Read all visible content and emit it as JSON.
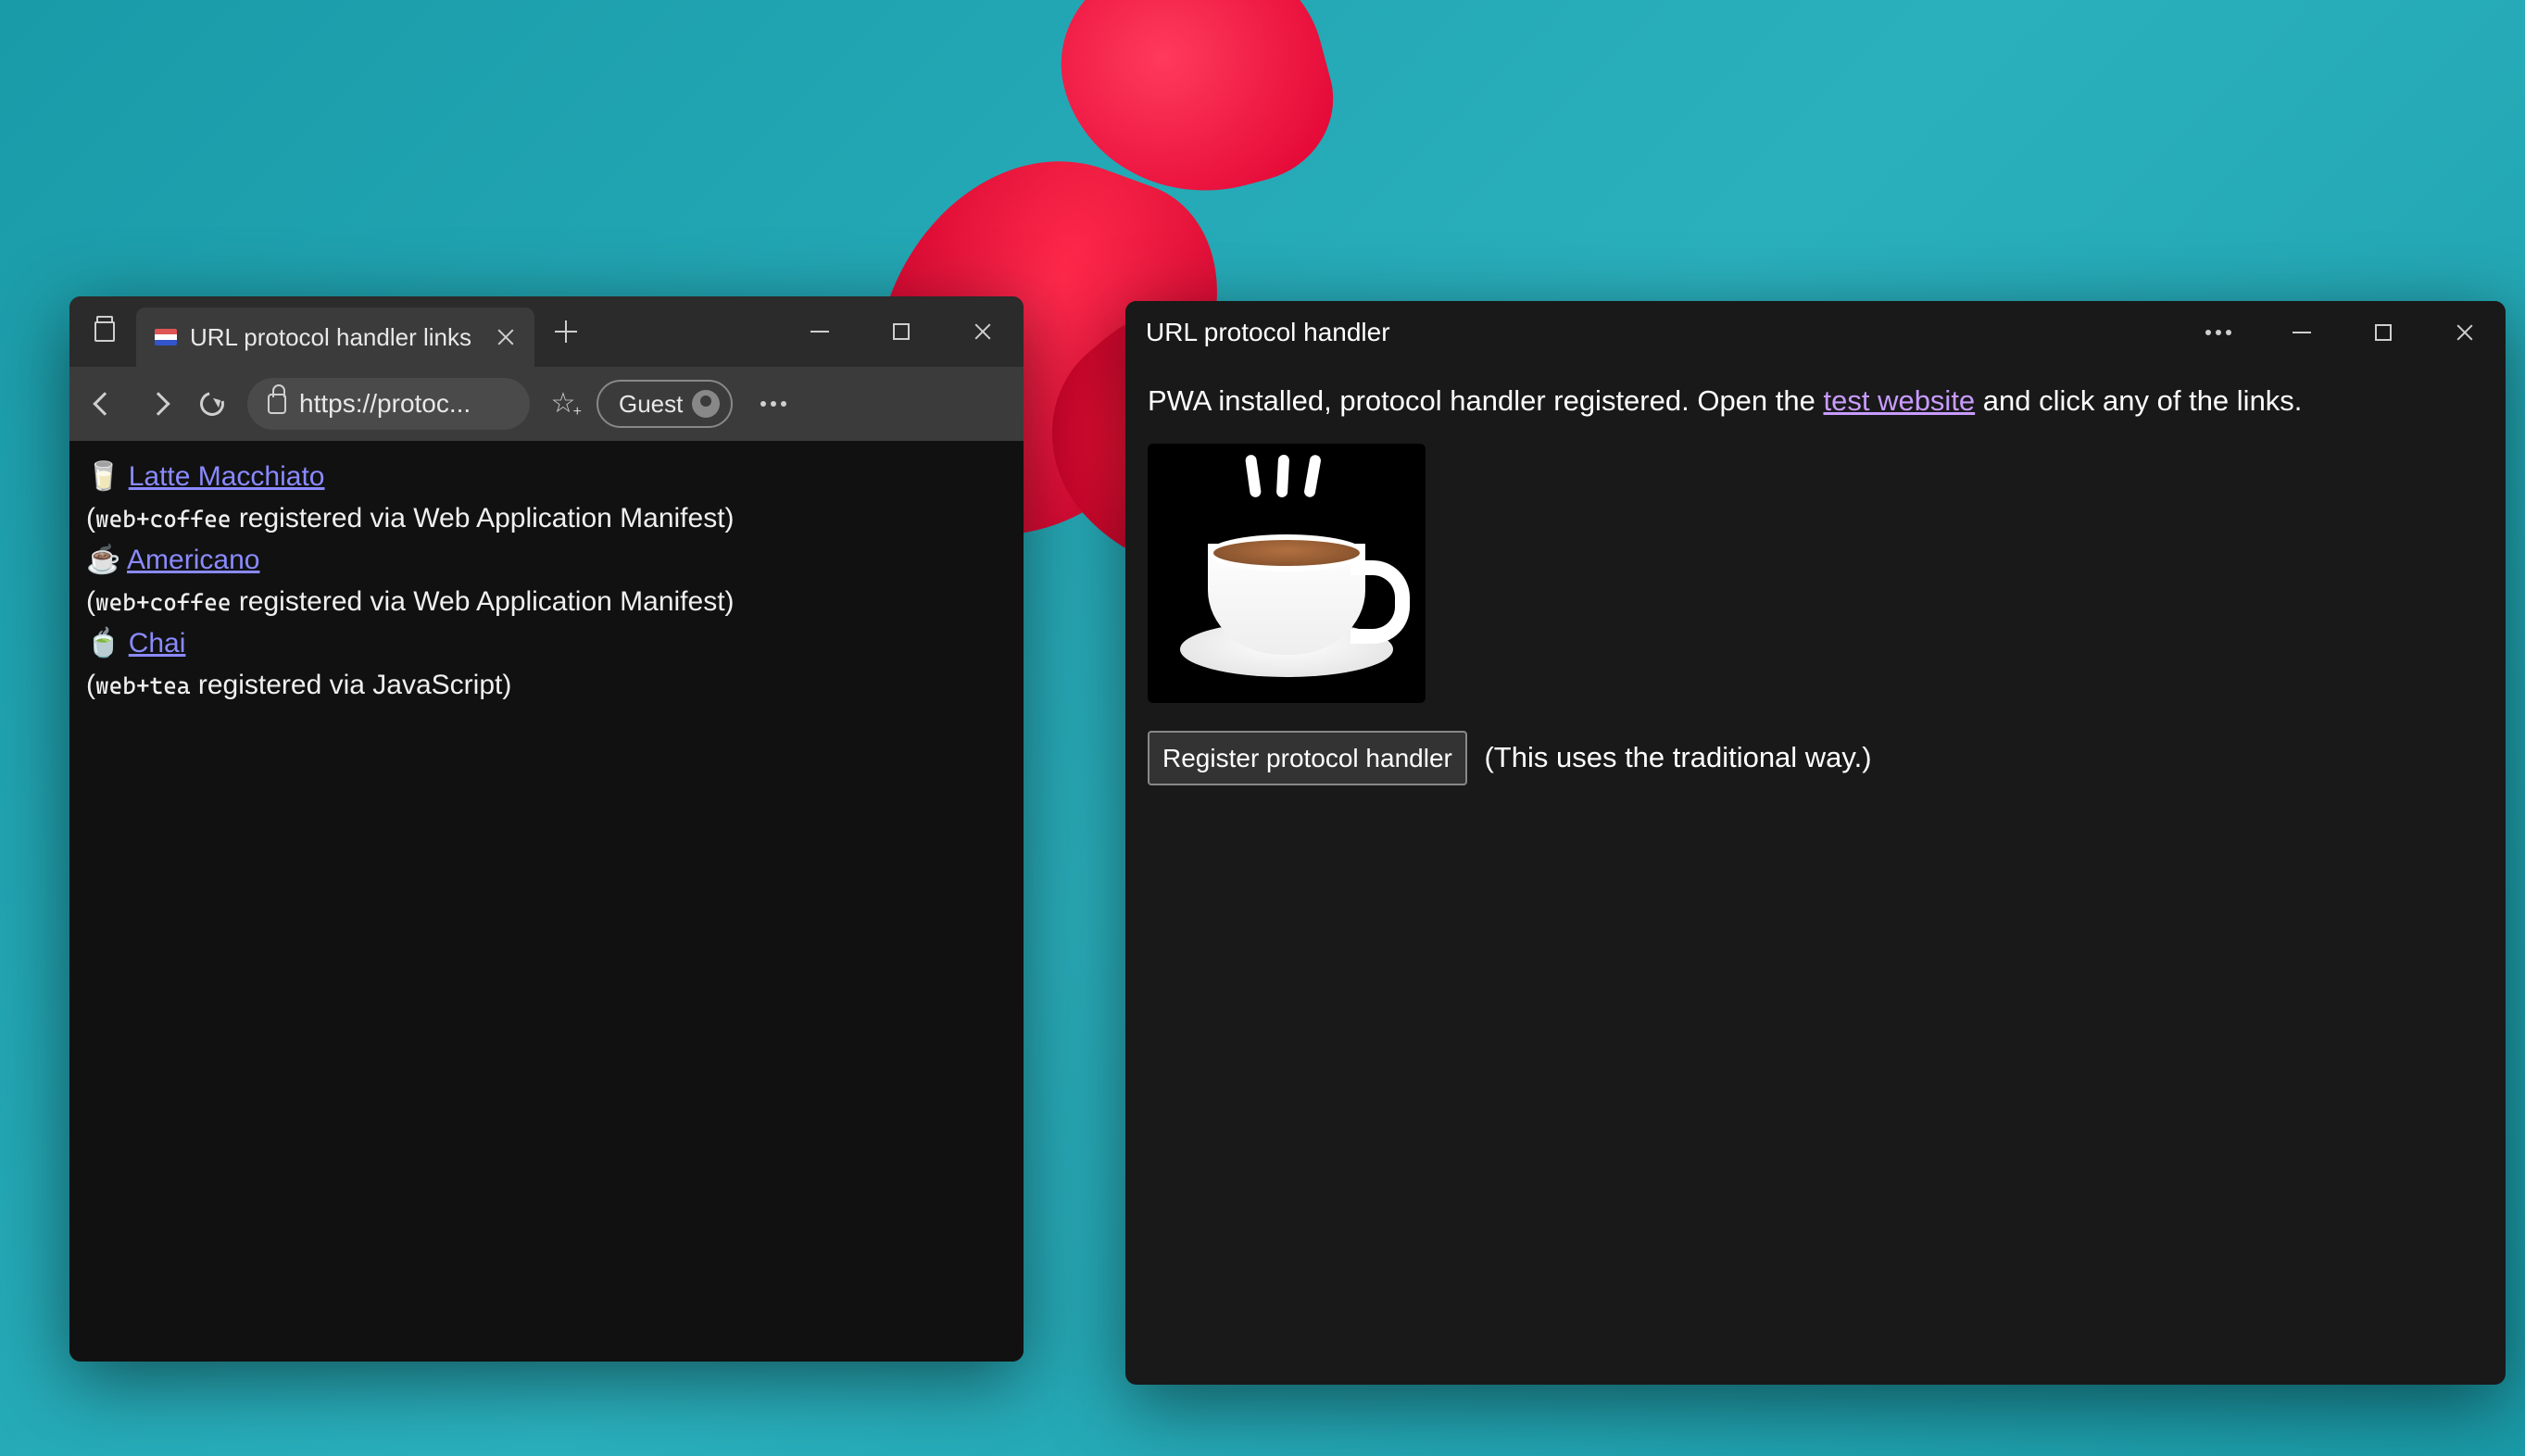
{
  "browser": {
    "tab_title": "URL protocol handler links",
    "url": "https://protoc...",
    "profile_label": "Guest",
    "links": [
      {
        "emoji": "🥛",
        "label": "Latte Macchiato",
        "sub_proto": "web+coffee",
        "sub_rest": " registered via Web Application Manifest)"
      },
      {
        "emoji": "☕",
        "label": "Americano",
        "sub_proto": "web+coffee",
        "sub_rest": " registered via Web Application Manifest)"
      },
      {
        "emoji": "🍵",
        "label": "Chai",
        "sub_proto": "web+tea",
        "sub_rest": " registered via JavaScript)"
      }
    ]
  },
  "pwa": {
    "title": "URL protocol handler",
    "intro_prefix": "PWA installed, protocol handler registered. Open the ",
    "intro_link": "test website",
    "intro_suffix": " and click any of the links.",
    "register_button": "Register protocol handler",
    "register_hint": "(This uses the traditional way.)"
  }
}
